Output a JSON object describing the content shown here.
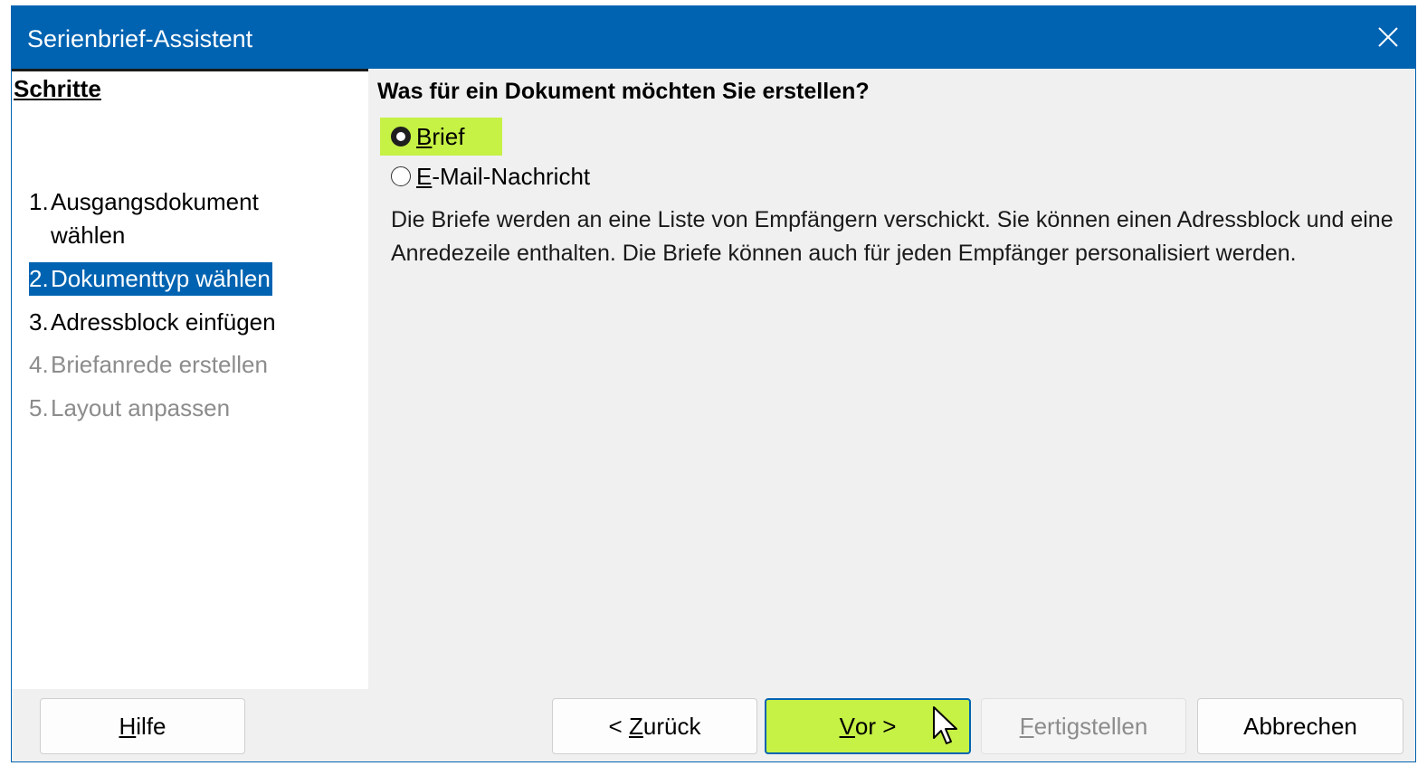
{
  "window": {
    "title": "Serienbrief-Assistent",
    "accent_color": "#0063b1",
    "highlight_color": "#c6f145"
  },
  "sidebar": {
    "heading": "Schritte",
    "steps": [
      {
        "number": "1.",
        "label_line1": "Ausgangsdokument",
        "label_line2": "wählen",
        "state": "enabled"
      },
      {
        "number": "2.",
        "label": "Dokumenttyp wählen",
        "state": "active"
      },
      {
        "number": "3.",
        "label": "Adressblock einfügen",
        "state": "enabled"
      },
      {
        "number": "4.",
        "label": "Briefanrede erstellen",
        "state": "disabled"
      },
      {
        "number": "5.",
        "label": "Layout anpassen",
        "state": "disabled"
      }
    ]
  },
  "main": {
    "question": "Was für ein Dokument möchten Sie erstellen?",
    "options": [
      {
        "mnemonic": "B",
        "rest": "rief",
        "checked": true
      },
      {
        "mnemonic": "E",
        "rest": "-Mail-Nachricht",
        "checked": false
      }
    ],
    "description": "Die Briefe werden an eine Liste von Empfängern verschickt. Sie können einen Adressblock und eine Anredezeile enthalten. Die Briefe können auch für jeden Empfänger personalisiert werden."
  },
  "buttons": {
    "help": {
      "mnemonic": "H",
      "rest": "ilfe"
    },
    "back": {
      "prefix": "< ",
      "mnemonic": "Z",
      "rest": "urück"
    },
    "next": {
      "mnemonic": "V",
      "rest": "or >"
    },
    "finish": {
      "mnemonic": "F",
      "rest": "ertigstellen",
      "disabled": true
    },
    "cancel": {
      "label": "Abbrechen"
    }
  },
  "icons": {
    "close": "close-icon",
    "cursor": "mouse-pointer-icon"
  }
}
